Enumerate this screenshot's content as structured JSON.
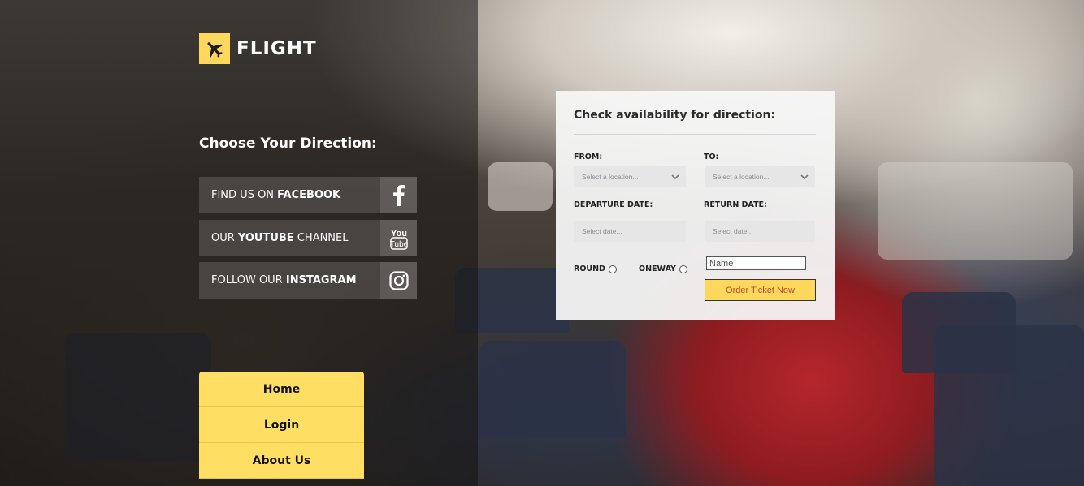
{
  "brand": {
    "name": "FLIGHT",
    "accent_color": "#fed85d",
    "icon": "airplane-icon"
  },
  "directions": {
    "title": "Choose Your Direction:",
    "social": [
      {
        "prefix": "FIND US ON ",
        "strong": "FACEBOOK",
        "suffix": "",
        "icon": "facebook-icon"
      },
      {
        "prefix": "OUR ",
        "strong": "YOUTUBE",
        "suffix": " CHANNEL",
        "icon": "youtube-icon"
      },
      {
        "prefix": "FOLLOW OUR ",
        "strong": "INSTAGRAM",
        "suffix": "",
        "icon": "instagram-icon"
      }
    ]
  },
  "menu": {
    "items": [
      "Home",
      "Login",
      "About Us"
    ]
  },
  "booking": {
    "title": "Check availability for direction:",
    "from_label": "FROM:",
    "to_label": "TO:",
    "location_placeholder": "Select a location...",
    "departure_label": "DEPARTURE DATE:",
    "return_label": "RETURN DATE:",
    "date_placeholder": "Select date...",
    "round_label": "ROUND",
    "oneway_label": "ONEWAY",
    "name_placeholder": "Name",
    "order_button": "Order Ticket Now"
  }
}
